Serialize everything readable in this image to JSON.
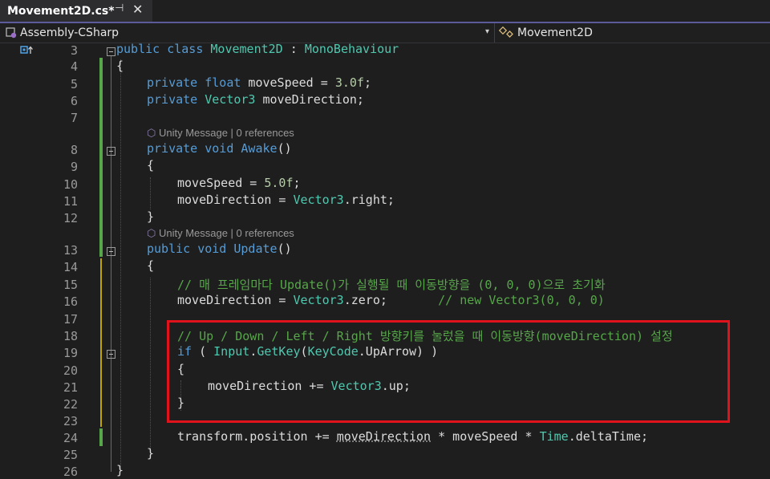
{
  "tab": {
    "title": "Movement2D.cs*",
    "pin_glyph": "⊣",
    "close_glyph": "✕"
  },
  "nav": {
    "project": "Assembly-CSharp",
    "class": "Movement2D",
    "drop_glyph": "▾"
  },
  "lens": {
    "awake": "Unity Message | 0 references",
    "update": "Unity Message | 0 references"
  },
  "lines": [
    {
      "n": "3"
    },
    {
      "n": "4"
    },
    {
      "n": "5"
    },
    {
      "n": "6"
    },
    {
      "n": "7"
    },
    {
      "n": "8"
    },
    {
      "n": "9"
    },
    {
      "n": "10"
    },
    {
      "n": "11"
    },
    {
      "n": "12"
    },
    {
      "n": "13"
    },
    {
      "n": "14"
    },
    {
      "n": "15"
    },
    {
      "n": "16"
    },
    {
      "n": "17"
    },
    {
      "n": "18"
    },
    {
      "n": "19"
    },
    {
      "n": "20"
    },
    {
      "n": "21"
    },
    {
      "n": "22"
    },
    {
      "n": "23"
    },
    {
      "n": "24"
    },
    {
      "n": "25"
    },
    {
      "n": "26"
    }
  ],
  "code": {
    "l3": [
      "public",
      " ",
      "class",
      " ",
      "Movement2D",
      " : ",
      "MonoBehaviour"
    ],
    "l4": "{",
    "l5": [
      "private",
      " ",
      "float",
      " moveSpeed = ",
      "3.0f",
      ";"
    ],
    "l6": [
      "private",
      " ",
      "Vector3",
      " moveDirection;"
    ],
    "l8": [
      "private",
      " ",
      "void",
      " ",
      "Awake",
      "()"
    ],
    "l9": "{",
    "l10": [
      "moveSpeed = ",
      "5.0f",
      ";"
    ],
    "l11": [
      "moveDirection = ",
      "Vector3",
      ".right;"
    ],
    "l12": "}",
    "l13": [
      "public",
      " ",
      "void",
      " ",
      "Update",
      "()"
    ],
    "l14": "{",
    "l15": "// 매 프레임마다 Update()가 실행될 때 이동방향을 (0, 0, 0)으로 초기화",
    "l16": [
      "moveDirection = ",
      "Vector3",
      ".zero;",
      "       // new Vector3(0, 0, 0)"
    ],
    "l18": "// Up / Down / Left / Right 방향키를 눌렀을 때 이동방향(moveDirection) 설정",
    "l19": [
      "if",
      " ( ",
      "Input",
      ".",
      "GetKey",
      "(",
      "KeyCode",
      ".UpArrow) )"
    ],
    "l20": "{",
    "l21": [
      "moveDirection += ",
      "Vector3",
      ".up;"
    ],
    "l22": "}",
    "l24": [
      "transform.position += ",
      "moveDirection",
      " * moveSpeed * ",
      "Time",
      ".deltaTime;"
    ],
    "l25": "}",
    "l26": "}"
  },
  "colors": {
    "keyword": "#569cd6",
    "type": "#4ec9b0",
    "number": "#b5cea8",
    "comment": "#57a64a",
    "method": "#dcdcaa",
    "highlight_box": "#e0121b"
  }
}
